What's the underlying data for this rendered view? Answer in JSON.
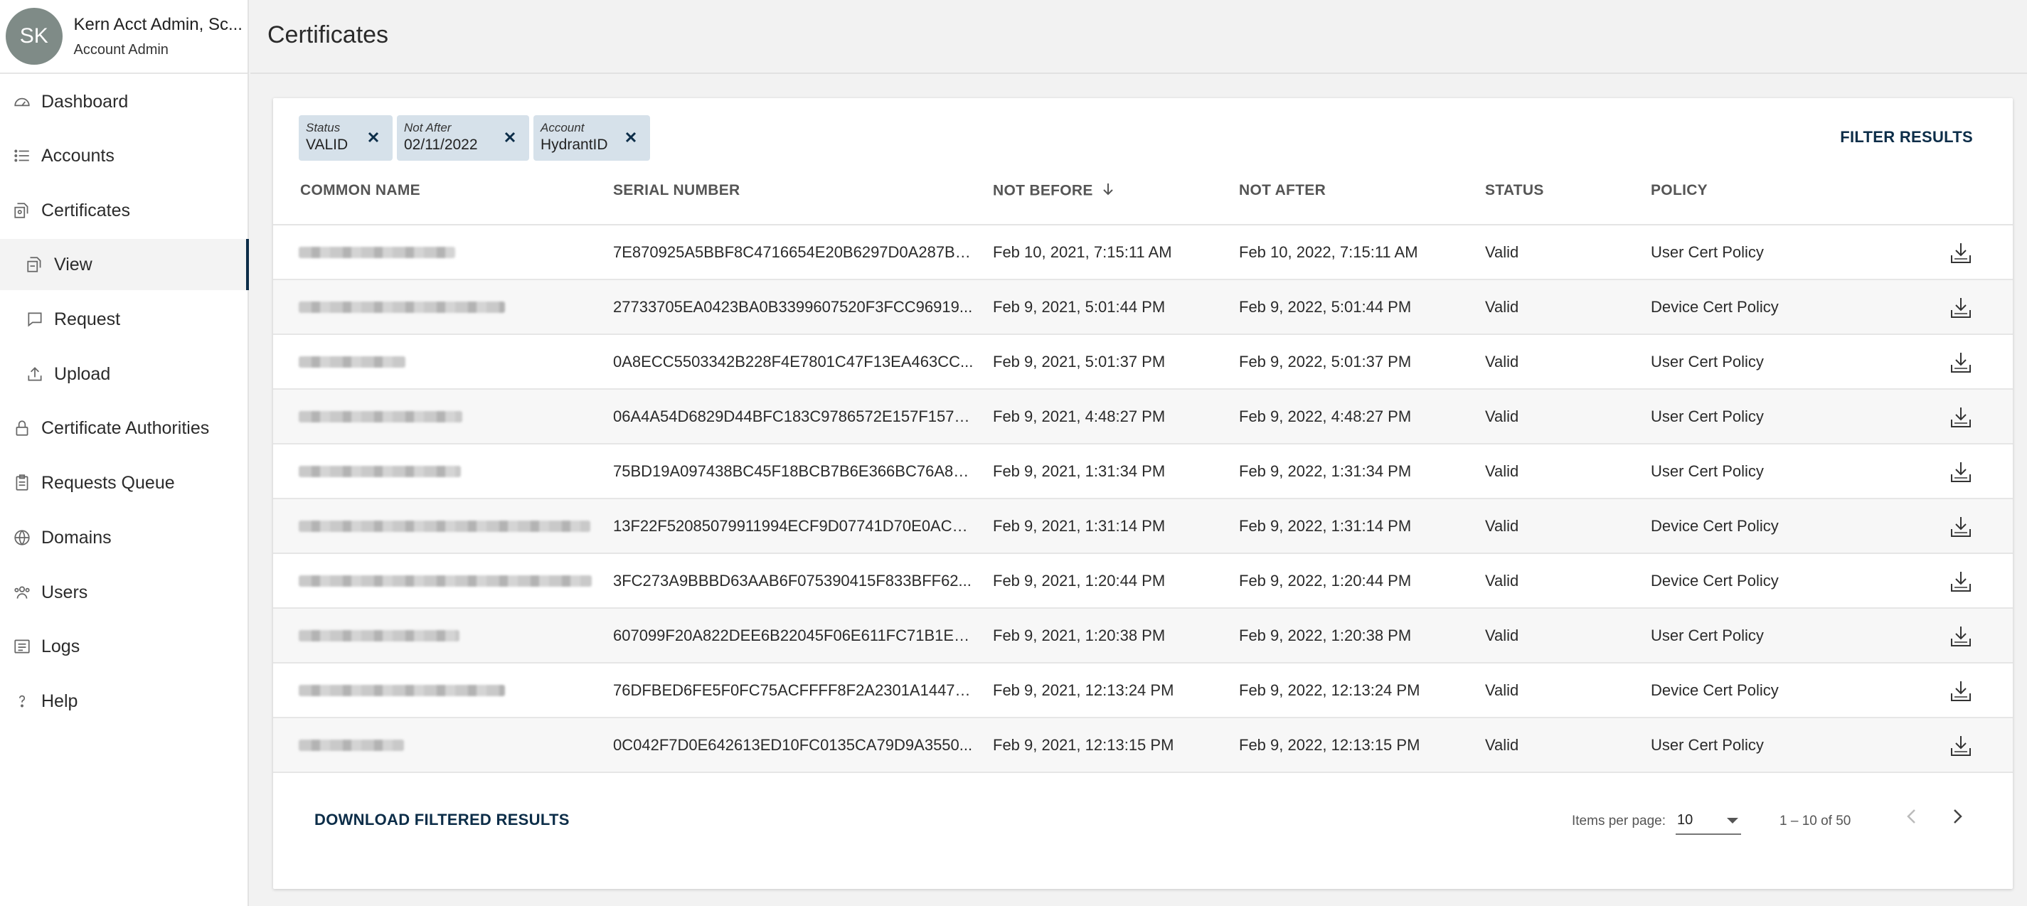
{
  "user": {
    "initials": "SK",
    "name": "Kern Acct Admin, Sc...",
    "role": "Account Admin"
  },
  "nav": [
    {
      "label": "Dashboard",
      "icon": "dashboard-icon"
    },
    {
      "label": "Accounts",
      "icon": "list-icon"
    },
    {
      "label": "Certificates",
      "icon": "certificate-icon"
    },
    {
      "label": "View",
      "icon": "certificate-view-icon",
      "active": true
    },
    {
      "label": "Request",
      "icon": "request-icon"
    },
    {
      "label": "Upload",
      "icon": "upload-icon"
    },
    {
      "label": "Certificate Authorities",
      "icon": "lock-icon"
    },
    {
      "label": "Requests Queue",
      "icon": "clipboard-icon"
    },
    {
      "label": "Domains",
      "icon": "globe-icon"
    },
    {
      "label": "Users",
      "icon": "users-icon"
    },
    {
      "label": "Logs",
      "icon": "logs-icon"
    },
    {
      "label": "Help",
      "icon": "help-icon"
    }
  ],
  "header": {
    "title": "Certificates"
  },
  "filters": [
    {
      "label": "Status",
      "value": "VALID"
    },
    {
      "label": "Not After",
      "value": "02/11/2022"
    },
    {
      "label": "Account",
      "value": "HydrantID"
    }
  ],
  "filter_button": "FILTER RESULTS",
  "columns": [
    "COMMON NAME",
    "SERIAL NUMBER",
    "NOT BEFORE",
    "NOT AFTER",
    "STATUS",
    "POLICY"
  ],
  "sort": {
    "column": "NOT BEFORE",
    "direction": "descending",
    "icon": "arrow-down-icon"
  },
  "rows": [
    {
      "serial": "7E870925A5BBF8C4716654E20B6297D0A287B9...",
      "not_before": "Feb 10, 2021, 7:15:11 AM",
      "not_after": "Feb 10, 2022, 7:15:11 AM",
      "status": "Valid",
      "policy": "User Cert Policy"
    },
    {
      "serial": "27733705EA0423BA0B3399607520F3FCC96919...",
      "not_before": "Feb 9, 2021, 5:01:44 PM",
      "not_after": "Feb 9, 2022, 5:01:44 PM",
      "status": "Valid",
      "policy": "Device Cert Policy"
    },
    {
      "serial": "0A8ECC5503342B228F4E7801C47F13EA463CC...",
      "not_before": "Feb 9, 2021, 5:01:37 PM",
      "not_after": "Feb 9, 2022, 5:01:37 PM",
      "status": "Valid",
      "policy": "User Cert Policy"
    },
    {
      "serial": "06A4A54D6829D44BFC183C9786572E157F1573...",
      "not_before": "Feb 9, 2021, 4:48:27 PM",
      "not_after": "Feb 9, 2022, 4:48:27 PM",
      "status": "Valid",
      "policy": "User Cert Policy"
    },
    {
      "serial": "75BD19A097438BC45F18BCB7B6E366BC76A8B...",
      "not_before": "Feb 9, 2021, 1:31:34 PM",
      "not_after": "Feb 9, 2022, 1:31:34 PM",
      "status": "Valid",
      "policy": "User Cert Policy"
    },
    {
      "serial": "13F22F52085079911994ECF9D07741D70E0ACD...",
      "not_before": "Feb 9, 2021, 1:31:14 PM",
      "not_after": "Feb 9, 2022, 1:31:14 PM",
      "status": "Valid",
      "policy": "Device Cert Policy"
    },
    {
      "serial": "3FC273A9BBBD63AAB6F075390415F833BFF62...",
      "not_before": "Feb 9, 2021, 1:20:44 PM",
      "not_after": "Feb 9, 2022, 1:20:44 PM",
      "status": "Valid",
      "policy": "Device Cert Policy"
    },
    {
      "serial": "607099F20A822DEE6B22045F06E611FC71B1EE...",
      "not_before": "Feb 9, 2021, 1:20:38 PM",
      "not_after": "Feb 9, 2022, 1:20:38 PM",
      "status": "Valid",
      "policy": "User Cert Policy"
    },
    {
      "serial": "76DFBED6FE5F0FC75ACFFFF8F2A2301A14471...",
      "not_before": "Feb 9, 2021, 12:13:24 PM",
      "not_after": "Feb 9, 2022, 12:13:24 PM",
      "status": "Valid",
      "policy": "Device Cert Policy"
    },
    {
      "serial": "0C042F7D0E642613ED10FC0135CA79D9A3550...",
      "not_before": "Feb 9, 2021, 12:13:15 PM",
      "not_after": "Feb 9, 2022, 12:13:15 PM",
      "status": "Valid",
      "policy": "User Cert Policy"
    }
  ],
  "row_icon": "download-icon",
  "footer": {
    "download_filtered": "DOWNLOAD FILTERED RESULTS",
    "items_per_page_label": "Items per page:",
    "items_per_page": "10",
    "range": "1 – 10 of 50"
  }
}
